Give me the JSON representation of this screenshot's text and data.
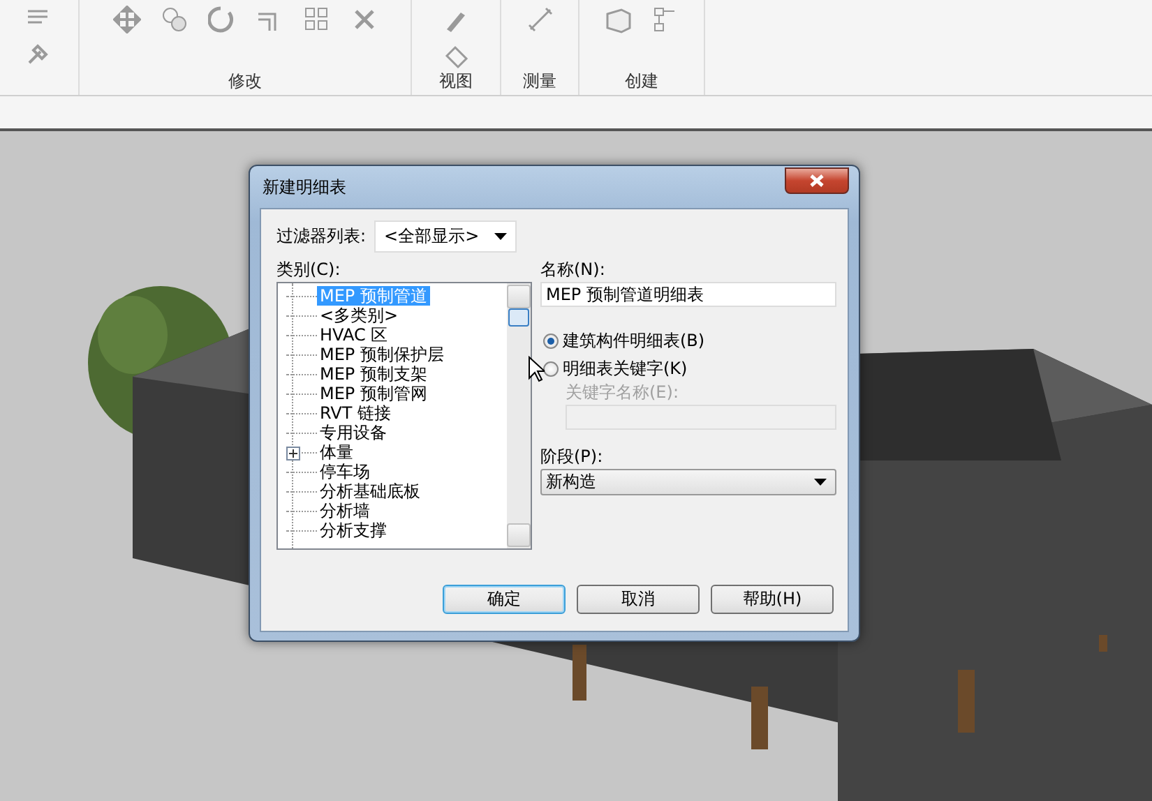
{
  "ribbon": {
    "panels": [
      {
        "label": "修改"
      },
      {
        "label": "视图"
      },
      {
        "label": "测量"
      },
      {
        "label": "创建"
      }
    ]
  },
  "dialog": {
    "title": "新建明细表",
    "filter": {
      "label": "过滤器列表:",
      "value": "<全部显示>"
    },
    "category": {
      "label": "类别(C):",
      "items": [
        {
          "label": "MEP 预制管道",
          "kind": "leaf",
          "selected": true
        },
        {
          "label": "<多类别>",
          "kind": "leaf",
          "selected": false
        },
        {
          "label": "HVAC 区",
          "kind": "leaf",
          "selected": false
        },
        {
          "label": "MEP 预制保护层",
          "kind": "leaf",
          "selected": false
        },
        {
          "label": "MEP 预制支架",
          "kind": "leaf",
          "selected": false
        },
        {
          "label": "MEP 预制管网",
          "kind": "leaf",
          "selected": false
        },
        {
          "label": "RVT 链接",
          "kind": "leaf",
          "selected": false
        },
        {
          "label": "专用设备",
          "kind": "leaf",
          "selected": false
        },
        {
          "label": "体量",
          "kind": "group",
          "selected": false
        },
        {
          "label": "停车场",
          "kind": "leaf",
          "selected": false
        },
        {
          "label": "分析基础底板",
          "kind": "leaf",
          "selected": false
        },
        {
          "label": "分析墙",
          "kind": "leaf",
          "selected": false
        },
        {
          "label": "分析支撑",
          "kind": "leaf",
          "selected": false
        }
      ]
    },
    "name": {
      "label": "名称(N):",
      "value": "MEP 预制管道明细表"
    },
    "schedule_types": [
      {
        "label": "建筑构件明细表(B)",
        "selected": true
      },
      {
        "label": "明细表关键字(K)",
        "selected": false
      }
    ],
    "key_name": {
      "label": "关键字名称(E):",
      "disabled": true
    },
    "phase": {
      "label": "阶段(P):",
      "value": "新构造"
    },
    "buttons": [
      {
        "label": "确定",
        "default": true
      },
      {
        "label": "取消",
        "default": false
      },
      {
        "label": "帮助(H)",
        "default": false
      }
    ]
  }
}
